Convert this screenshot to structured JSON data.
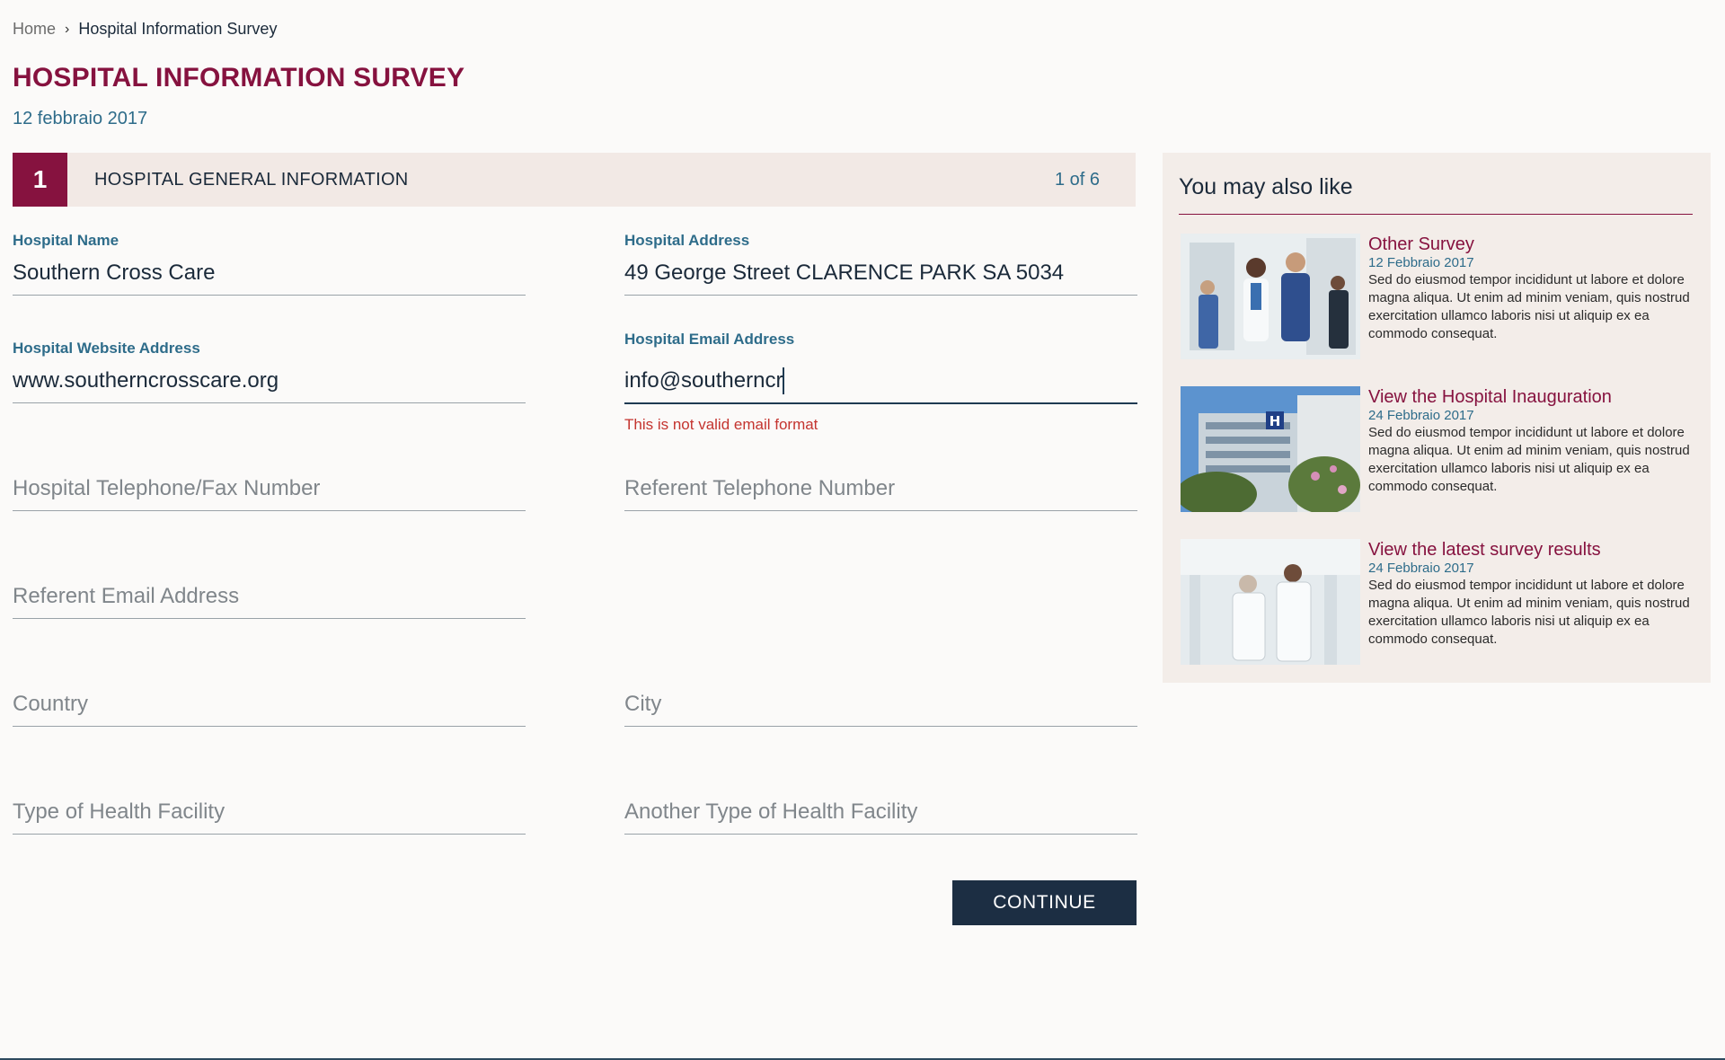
{
  "breadcrumb": {
    "home": "Home",
    "separator": "›",
    "current": "Hospital Information Survey"
  },
  "page": {
    "title": "HOSPITAL INFORMATION SURVEY",
    "date": "12 febbraio 2017"
  },
  "step": {
    "number": "1",
    "title": "HOSPITAL GENERAL INFORMATION",
    "count": "1 of 6"
  },
  "form": {
    "hospital_name": {
      "label": "Hospital Name",
      "value": "Southern Cross Care"
    },
    "hospital_address": {
      "label": "Hospital Address",
      "value": "49 George Street CLARENCE PARK SA 5034"
    },
    "website": {
      "label": "Hospital Website Address",
      "value": "www.southerncrosscare.org"
    },
    "email": {
      "label": "Hospital Email Address",
      "value": "info@southerncr",
      "error": "This is not valid email format"
    },
    "telephone_fax": {
      "placeholder": "Hospital Telephone/Fax Number"
    },
    "referent_telephone": {
      "placeholder": "Referent Telephone Number"
    },
    "referent_email": {
      "placeholder": "Referent Email Address"
    },
    "country": {
      "placeholder": "Country"
    },
    "city": {
      "placeholder": "City"
    },
    "facility_type": {
      "placeholder": "Type of Health Facility"
    },
    "another_facility_type": {
      "placeholder": "Another Type of Health Facility"
    },
    "continue_label": "CONTINUE"
  },
  "sidebar": {
    "title": "You may also like",
    "items": [
      {
        "title": "Other Survey",
        "date": "12 Febbraio 2017",
        "text": "Sed do eiusmod tempor incididunt ut labore et dolore magna aliqua. Ut enim ad minim veniam, quis nostrud exercitation ullamco laboris nisi ut aliquip ex ea commodo consequat."
      },
      {
        "title": "View the Hospital Inauguration",
        "date": "24 Febbraio 2017",
        "text": "Sed do eiusmod tempor incididunt ut labore et dolore magna aliqua. Ut enim ad minim veniam, quis nostrud exercitation ullamco laboris nisi ut aliquip ex ea commodo consequat."
      },
      {
        "title": "View the latest survey results",
        "date": "24 Febbraio 2017",
        "text": "Sed do eiusmod tempor incididunt ut labore et dolore magna aliqua. Ut enim ad minim veniam, quis nostrud exercitation ullamco laboris nisi ut aliquip ex ea commodo consequat."
      }
    ]
  },
  "colors": {
    "brand": "#86123f",
    "label_blue": "#2e6c8a",
    "button_navy": "#1c2e43",
    "error_red": "#c4342f",
    "panel_beige": "#f3ede9"
  }
}
